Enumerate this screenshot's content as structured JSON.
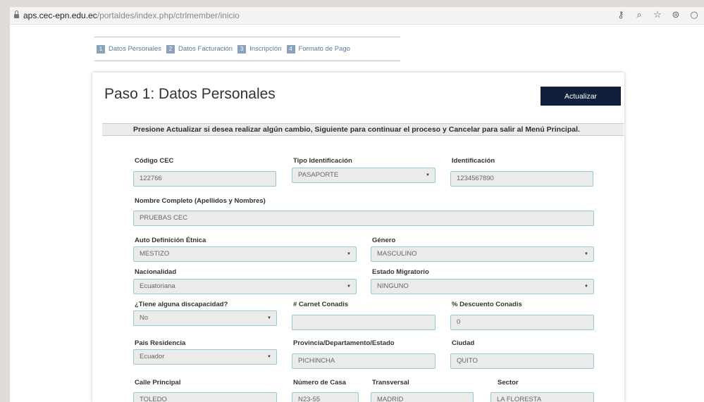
{
  "browser": {
    "url_host": "aps.cec-epn.edu.ec",
    "url_path": "/portaldes/index.php/ctrlmember/inicio",
    "icons": [
      "key-icon",
      "zoom-icon",
      "star-icon",
      "extension-icon",
      "opera-icon"
    ]
  },
  "steps": [
    {
      "num": "1",
      "label": "Datos Personales"
    },
    {
      "num": "2",
      "label": "Datos Facturación"
    },
    {
      "num": "3",
      "label": "Inscripción"
    },
    {
      "num": "4",
      "label": "Formato de Pago"
    }
  ],
  "page": {
    "title": "Paso 1: Datos Personales",
    "update_button": "Actualizar",
    "notice": "Presione Actualizar si desea realizar algún cambio, Siguiente para continuar el proceso y Cancelar para salir al Menú Principal."
  },
  "form": {
    "codigo_cec": {
      "label": "Código CEC",
      "value": "122766"
    },
    "tipo_identificacion": {
      "label": "Tipo Identificación",
      "value": "PASAPORTE"
    },
    "identificacion": {
      "label": "Identificación",
      "value": "1234567890"
    },
    "nombre_completo": {
      "label": "Nombre Completo (Apellidos y Nombres)",
      "value": "PRUEBAS CEC"
    },
    "etnica": {
      "label": "Auto Definición Étnica",
      "value": "MESTIZO"
    },
    "genero": {
      "label": "Género",
      "value": "MASCULINO"
    },
    "nacionalidad": {
      "label": "Nacionalidad",
      "value": "Ecuatoriana"
    },
    "estado_migratorio": {
      "label": "Estado Migratorio",
      "value": "NINGUNO"
    },
    "discapacidad": {
      "label": "¿Tiene alguna discapacidad?",
      "value": "No"
    },
    "carnet_conadis": {
      "label": "# Carnet Conadis",
      "value": ""
    },
    "descuento_conadis": {
      "label": "% Descuento Conadis",
      "value": "0"
    },
    "pais_residencia": {
      "label": "Pais Residencia",
      "value": "Ecuador"
    },
    "provincia": {
      "label": "Provincia/Departamento/Estado",
      "value": "PICHINCHA"
    },
    "ciudad": {
      "label": "Ciudad",
      "value": "QUITO"
    },
    "calle_principal": {
      "label": "Calle Principal",
      "value": "TOLEDO"
    },
    "numero_casa": {
      "label": "Número de Casa",
      "value": "N23-55"
    },
    "transversal": {
      "label": "Transversal",
      "value": "MADRID"
    },
    "sector": {
      "label": "Sector",
      "value": "LA FLORESTA"
    }
  }
}
